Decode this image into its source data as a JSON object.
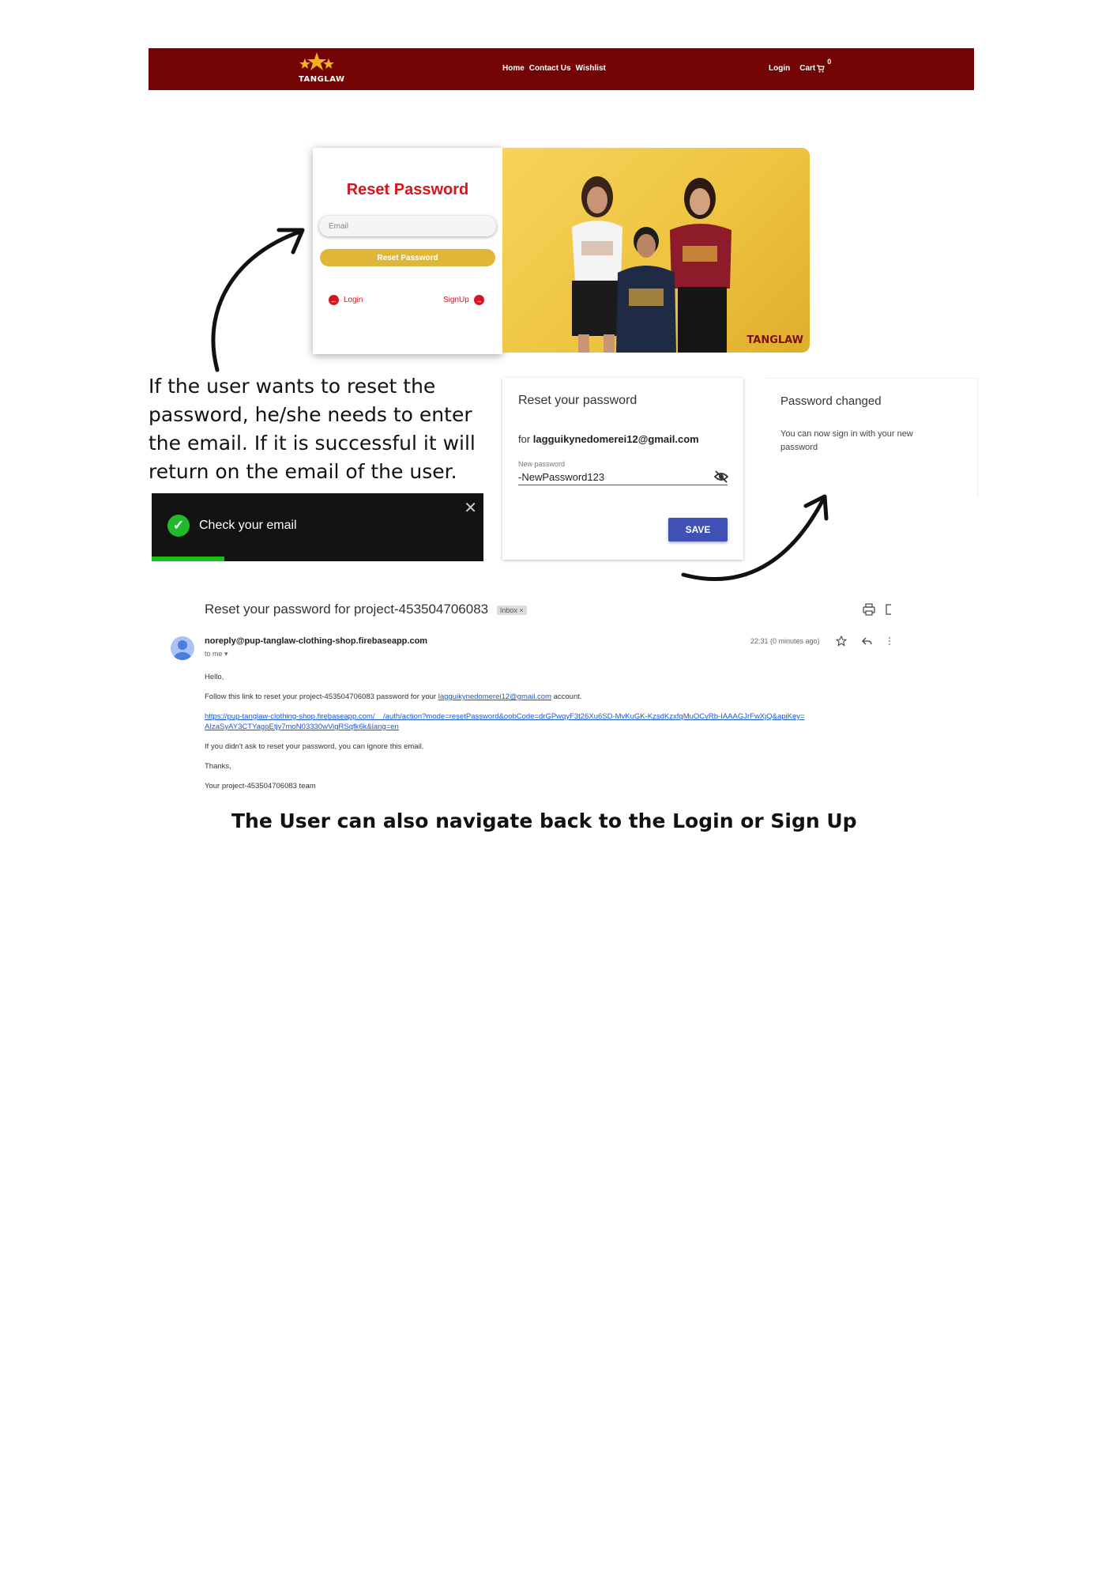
{
  "navbar": {
    "logo_text": "TANGLAW",
    "links": [
      "Home",
      "Contact Us",
      "Wishlist"
    ],
    "login": "Login",
    "cart": "Cart",
    "cart_count": "0",
    "bg_color": "#740303"
  },
  "reset_form": {
    "title": "Reset Password",
    "email_placeholder": "Email",
    "button": "Reset Password",
    "login_link": "Login",
    "signup_link": "SignUp",
    "accent_color": "#d6161c",
    "button_color": "#e0b637"
  },
  "photo": {
    "logo_text": "TANGLAW"
  },
  "description": "If the user wants to reset the password, he/she needs to enter the email. If it is successful it will return on the email of the user.",
  "toast": {
    "message": "Check your email",
    "close": "✕",
    "progress": 0.22
  },
  "reset_card": {
    "title": "Reset your password",
    "for_prefix": "for",
    "email": "lagguikynedomerei12@gmail.com",
    "field_label": "New password",
    "field_value": "-NewPassword123",
    "save": "SAVE"
  },
  "changed_card": {
    "title": "Password changed",
    "text": "You can now sign in with your new password"
  },
  "email": {
    "subject": "Reset your password for project-453504706083",
    "badge": "Inbox ×",
    "sender": "noreply@pup-tanglaw-clothing-shop.firebaseapp.com",
    "to": "to me ▾",
    "time": "22:31 (0 minutes ago)",
    "greeting": "Hello,",
    "line1_pre": "Follow this link to reset your project-453504706083 password for your",
    "line1_link": "lagguikynedomerei12@gmail.com",
    "line1_post": "account.",
    "link_line1": "https://pup-tanglaw-clothing-shop.firebaseapp.com/__/auth/action?mode=resetPassword&oobCode=drGPwqyF3t26Xu6SD-MvKuGK-KzsdKzxfqMuOCvRb-IAAAGJrFwXjQ&apiKey=",
    "link_line2": "AIzaSyAY3CTYagoEtjy7moN03330wVigRSqfk6k&lang=en",
    "ignore": "If you didn't ask to reset your password, you can ignore this email.",
    "thanks": "Thanks,",
    "team": "Your project-453504706083 team"
  },
  "caption": "The User can also navigate back to the Login or Sign Up"
}
